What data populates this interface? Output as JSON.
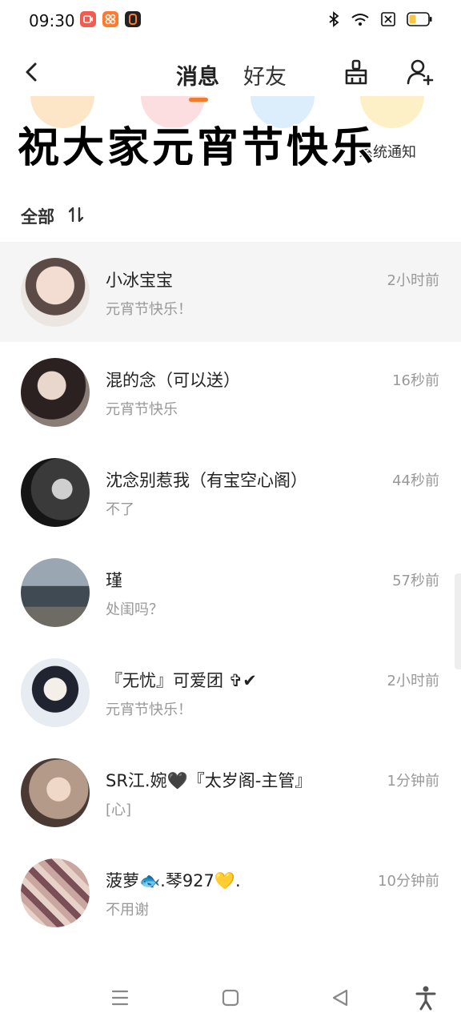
{
  "status_bar": {
    "time": "09:30",
    "app_badges": [
      {
        "icon": "video-app-icon",
        "color": "#f25b4f"
      },
      {
        "icon": "grid-app-icon",
        "color": "#ff7a2e"
      },
      {
        "icon": "zero-app-icon",
        "color": "#222222"
      }
    ],
    "right_icons": [
      "bluetooth-icon",
      "wifi-icon",
      "sim-x-icon",
      "battery-icon"
    ],
    "battery_level": 0.3
  },
  "header": {
    "tab_messages": "消息",
    "tab_friends": "好友",
    "icons": [
      "back-icon",
      "broom-icon",
      "add-friend-icon"
    ]
  },
  "shortcuts": {
    "partial_label": "系统通知",
    "colors": [
      "#f9b347",
      "#f27e86",
      "#4aa9f0",
      "#f7d774"
    ]
  },
  "overlay_caption": "祝大家元宵节快乐",
  "filter": {
    "label": "全部",
    "sort_icon": "sort-icon"
  },
  "conversations": [
    {
      "name": "小冰宝宝",
      "preview": "元宵节快乐！",
      "time": "2小时前",
      "pinned": true,
      "avatar_color": "#e8cfc4"
    },
    {
      "name": "混的念（可以送）",
      "preview": "元宵节快乐",
      "time": "16秒前",
      "pinned": false,
      "avatar_color": "#6b5a55"
    },
    {
      "name": "沈念别惹我（有宝空心阁）",
      "preview": "不了",
      "time": "44秒前",
      "pinned": false,
      "avatar_color": "#2b2b2b"
    },
    {
      "name": "瑾",
      "preview": "处闺吗？",
      "time": "57秒前",
      "pinned": false,
      "avatar_color": "#5f6a74"
    },
    {
      "name": "『无忧』可爱团 ✞✔",
      "preview": "元宵节快乐！",
      "time": "2小时前",
      "pinned": false,
      "avatar_color": "#dfe3ea"
    },
    {
      "name": "SR江.婉🖤『太岁阁-主管』",
      "preview": "[心]",
      "time": "1分钟前",
      "pinned": false,
      "avatar_color": "#a88a78"
    },
    {
      "name": "菠萝🐟.琴927💛.",
      "preview": "不用谢",
      "time": "10分钟前",
      "pinned": false,
      "avatar_color": "#b96d6d"
    }
  ],
  "nav_bar": {
    "icons": [
      "menu-icon",
      "home-square-icon",
      "back-triangle-icon",
      "accessibility-icon"
    ]
  }
}
